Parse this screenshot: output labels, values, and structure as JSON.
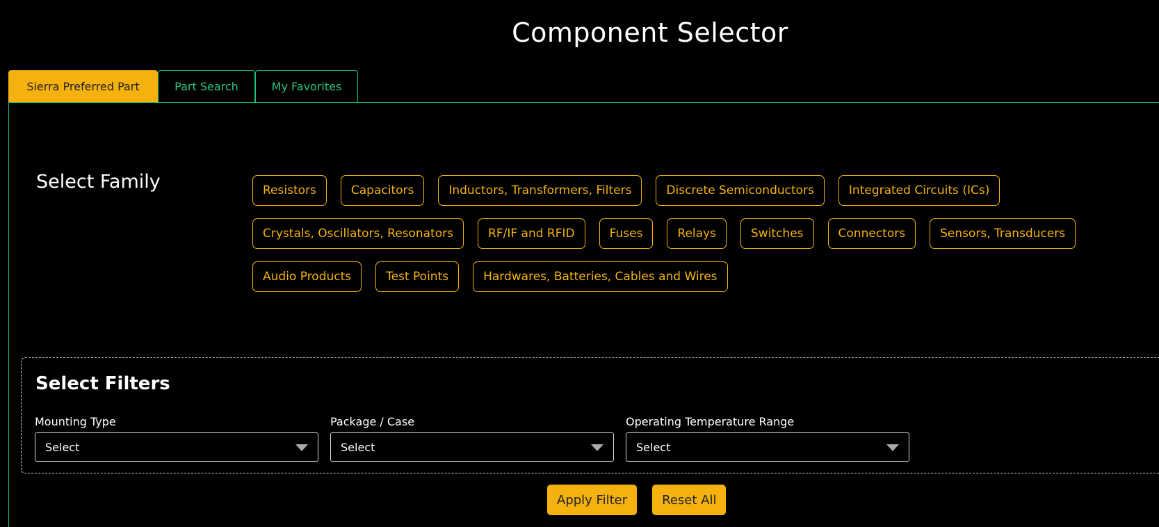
{
  "title": "Component Selector",
  "tabs": [
    {
      "label": "Sierra Preferred Part",
      "active": true
    },
    {
      "label": "Part Search",
      "active": false
    },
    {
      "label": "My Favorites",
      "active": false
    }
  ],
  "family": {
    "label": "Select Family",
    "items": [
      "Resistors",
      "Capacitors",
      "Inductors, Transformers, Filters",
      "Discrete Semiconductors",
      "Integrated Circuits (ICs)",
      "Crystals, Oscillators, Resonators",
      "RF/IF and RFID",
      "Fuses",
      "Relays",
      "Switches",
      "Connectors",
      "Sensors, Transducers",
      "Audio Products",
      "Test Points",
      "Hardwares, Batteries, Cables and Wires"
    ]
  },
  "filters": {
    "title": "Select Filters",
    "fields": [
      {
        "label": "Mounting Type",
        "value": "Select"
      },
      {
        "label": "Package / Case",
        "value": "Select"
      },
      {
        "label": "Operating Temperature Range",
        "value": "Select"
      }
    ]
  },
  "actions": {
    "apply_label": "Apply Filter",
    "reset_label": "Reset All"
  },
  "colors": {
    "accent": "#f5b20f",
    "tab_border": "#1bbf7a",
    "background": "#000000"
  }
}
